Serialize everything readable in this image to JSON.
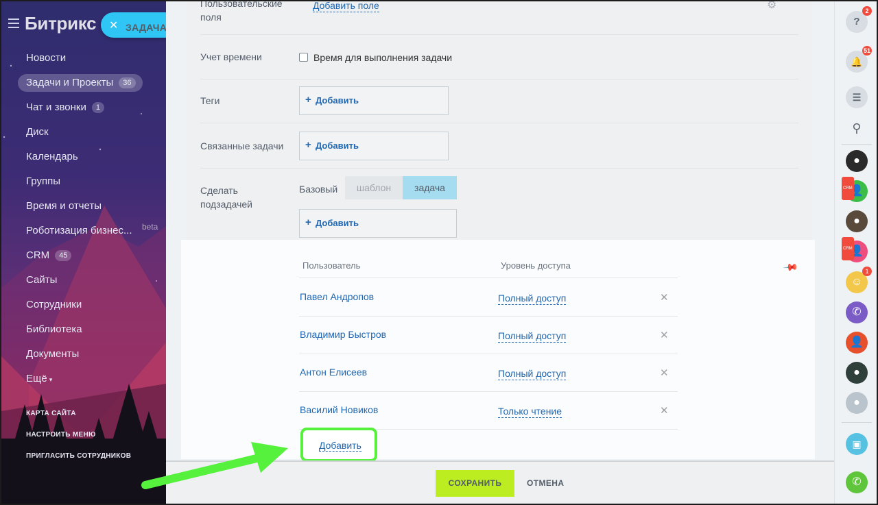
{
  "sidebar": {
    "logo": "Битрикс",
    "task_chip": "ЗАДАЧА",
    "items": [
      {
        "label": "Новости"
      },
      {
        "label": "Задачи и Проекты",
        "badge": "36"
      },
      {
        "label": "Чат и звонки",
        "badge": "1"
      },
      {
        "label": "Диск"
      },
      {
        "label": "Календарь"
      },
      {
        "label": "Группы"
      },
      {
        "label": "Время и отчеты"
      },
      {
        "label": "Роботизация бизнес..."
      },
      {
        "label": "CRM",
        "badge": "45"
      },
      {
        "label": "Сайты"
      },
      {
        "label": "Сотрудники"
      },
      {
        "label": "Библиотека"
      },
      {
        "label": "Документы"
      },
      {
        "label": "Ещё"
      }
    ],
    "beta": "beta",
    "more_arrow": "▾",
    "bottom_links": [
      "КАРТА САЙТА",
      "НАСТРОИТЬ МЕНЮ",
      "ПРИГЛАСИТЬ СОТРУДНИКОВ"
    ]
  },
  "form": {
    "user_fields_label": "Пользовательские поля",
    "user_fields_add": "Добавить поле",
    "time_label": "Учет времени",
    "time_checkbox": "Время для выполнения задачи",
    "tags_label": "Теги",
    "related_label": "Связанные задачи",
    "subtask_label": "Сделать подзадачей",
    "base_label": "Базовый",
    "seg_template": "шаблон",
    "seg_task": "задача",
    "add_label": "Добавить",
    "plus": "+"
  },
  "access": {
    "col_user": "Пользователь",
    "col_level": "Уровень доступа",
    "rows": [
      {
        "user": "Павел Андропов",
        "level": "Полный доступ"
      },
      {
        "user": "Владимир Быстров",
        "level": "Полный доступ"
      },
      {
        "user": "Антон Елисеев",
        "level": "Полный доступ"
      },
      {
        "user": "Василий Новиков",
        "level": "Только чтение"
      }
    ],
    "remove_glyph": "✕",
    "add_button": "Добавить"
  },
  "footer": {
    "save": "СОХРАНИТЬ",
    "cancel": "ОТМЕНА"
  },
  "rightbar": {
    "help_badge": "2",
    "notif_badge": "51",
    "crm_tag": "CRM",
    "avatar_badge": "1"
  },
  "colors": {
    "accent": "#2067b0",
    "save_green": "#bbed21",
    "highlight_green": "#55f13d",
    "task_chip": "#2fc6f6",
    "segment_active": "#a6dcef"
  }
}
